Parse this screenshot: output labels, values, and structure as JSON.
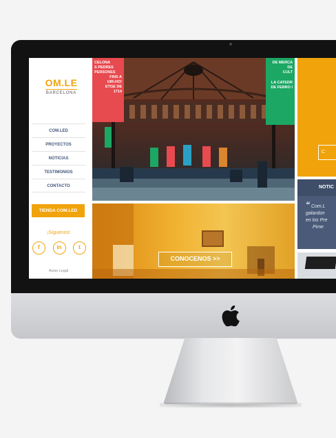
{
  "site": {
    "logo": {
      "main": "OM.LE",
      "sub": "BARCELONA"
    },
    "nav": [
      "COM.LED",
      "PROYECTOS",
      "NOTICIAS",
      "TESTIMONIOS",
      "CONTACTO"
    ],
    "shop_button": "TIENDA COM.LED",
    "follow_label": "¡Síguenos!",
    "socials": [
      {
        "icon": "facebook-icon",
        "glyph": "f"
      },
      {
        "icon": "linkedin-icon",
        "glyph": "in"
      },
      {
        "icon": "twitter-icon",
        "glyph": "t"
      }
    ],
    "legal": "Aviso Legal",
    "hero": {
      "banner_left": [
        "CELONA",
        "S PEDRES",
        "PERSONES",
        "FINS A",
        "UIR-HO!",
        "ETGE DE",
        "1714"
      ],
      "banner_right": [
        "DE MERCA",
        "DE",
        "CULT",
        "LA CATEDR",
        "DE FERRO I"
      ]
    },
    "cta_button": "CONOCENOS >>",
    "right_column": {
      "outline_button": "C",
      "noticias_title": "NOTIC",
      "quote_mark": "“",
      "quote_lines": [
        "Com.L",
        "galardon",
        "en los Pre",
        "Pime"
      ]
    }
  },
  "colors": {
    "brand_orange": "#f0a30a",
    "nav_text": "#45587c",
    "news_blue": "#4a5a78",
    "banner_red": "#e74a4f",
    "banner_green": "#1ca765"
  }
}
